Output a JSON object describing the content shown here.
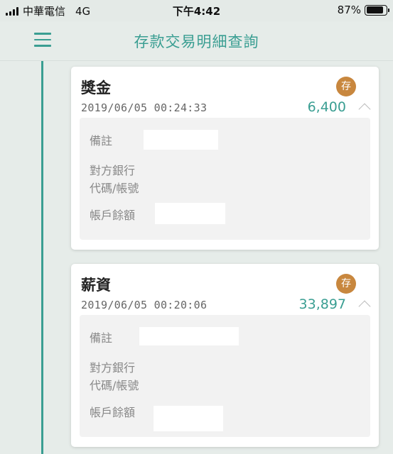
{
  "status_bar": {
    "carrier": "中華電信",
    "network": "4G",
    "time": "下午4:42",
    "battery": "87%"
  },
  "header": {
    "title": "存款交易明細查詢",
    "menu_icon": "hamburger-menu-icon"
  },
  "colors": {
    "accent": "#3a9e92",
    "badge": "#c8873e",
    "background": "#e6ece9"
  },
  "transactions": [
    {
      "title": "獎金",
      "datetime": "2019/06/05 00:24:33",
      "badge": "存",
      "amount": "6,400",
      "details": {
        "note_label": "備註",
        "bank_label_line1": "對方銀行",
        "bank_label_line2": "代碼/帳號",
        "balance_label": "帳戶餘額"
      }
    },
    {
      "title": "薪資",
      "datetime": "2019/06/05 00:20:06",
      "badge": "存",
      "amount": "33,897",
      "details": {
        "note_label": "備註",
        "bank_label_line1": "對方銀行",
        "bank_label_line2": "代碼/帳號",
        "balance_label": "帳戶餘額"
      }
    }
  ]
}
